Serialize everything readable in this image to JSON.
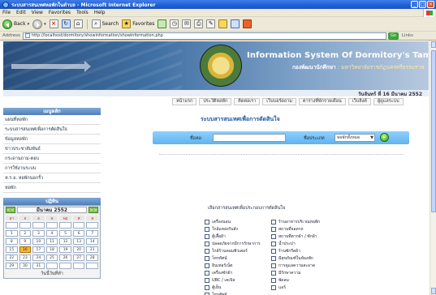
{
  "window": {
    "title": "ระบบสารสนเทศหอพักในตำบล - Microsoft Internet Explorer",
    "menu": [
      "File",
      "Edit",
      "View",
      "Favorites",
      "Tools",
      "Help"
    ],
    "toolbar": {
      "back": "Back",
      "search": "Search",
      "favorites": "Favorites"
    },
    "address_label": "Address",
    "address_url": "http://localhost/dormitory/showinformation/showinformation.php",
    "go_label": "Go",
    "links_label": "Links"
  },
  "banner": {
    "title": "Information System Of Dormitory's Tambon Thangew",
    "subtitle": "กองพัฒนานักศึกษา",
    "subtitle_extra": ": มหาวิทยาลัยราชภัฏนครศรีธรรมราช"
  },
  "date_text": "วันจันทร์ ที่ 16 มีนาคม 2552",
  "top_nav": [
    "หน้าแรก",
    "ประวัติหอพัก",
    "ติดต่อเรา",
    "เว็บบอร์ดถาม",
    "ตารางที่พักรายเดือน",
    "เว็บลิงค์",
    "ผู้ดูแลระบบ"
  ],
  "sidebar": {
    "menu_title": "เมนูหลัก",
    "items": [
      "แผนที่หอพัก",
      "ระบบสารสนเทศเพื่อการตัดสินใจ",
      "ข้อมูลหอพัก",
      "ข่าวประชาสัมพันธ์",
      "กระดานถาม-ตอบ",
      "การใช้งานระบบ",
      "ห.ร.อ. หอพักนอกรั้ว",
      "หอพัก"
    ],
    "calendar_title": "ปฏิทิน",
    "calendar_month": "มีนาคม 2552",
    "calendar_prev": "<<",
    "calendar_next": ">>",
    "day_headers": [
      "อา",
      "จ",
      "อ",
      "พ",
      "พฤ",
      "ศ",
      "ส"
    ],
    "days": [
      "",
      "",
      "",
      "",
      "",
      "",
      "",
      "1",
      "2",
      "3",
      "4",
      "5",
      "6",
      "7",
      "8",
      "9",
      "10",
      "11",
      "12",
      "13",
      "14",
      "15",
      "16",
      "17",
      "18",
      "19",
      "20",
      "21",
      "22",
      "23",
      "24",
      "25",
      "26",
      "27",
      "28",
      "29",
      "30",
      "31",
      "",
      "",
      "",
      ""
    ],
    "today": "16",
    "calendar_footer": "วันนี้วันที่ทำ"
  },
  "main": {
    "title": "ระบบสารสนเทศเพื่อการตัดสินใจ",
    "search": {
      "name_label": "ชื่อหอ",
      "name_value": "",
      "type_label": "ชื่อประเภท",
      "type_value": "หอพักทั้งหมด",
      "go": "Go"
    },
    "category_title": "เลือกสารสนเทศเพื่อประกอบการตัดสินใจ",
    "categories_left": [
      "เครื่องนอน",
      "ใกล้แหล่งรับสัง",
      "ตู้เสื้อผ้า",
      "ปลอดภัยจากมีการรักษาการ",
      "ใกล้ร้านคอมพิวเตอร์",
      "โทรทัศน์",
      "อินเทอร์เน็ต",
      "เครื่องซักผ้า",
      "UBC / เคเบิล",
      "ตู้เย็น",
      "โทรศัพท์"
    ],
    "categories_right": [
      "ร้านอาหารบริเวณหอพัก",
      "สถานที่จอดรถ",
      "สถานที่ตากผ้า / ซักผ้า",
      "น้ำประปา",
      "ร้านซักรีดผ้า",
      "มีสุขภัณฑ์ในห้องพัก",
      "การดูแลความสะอาด",
      "มีรักษาความ",
      "พัดลม",
      "แอร์"
    ]
  }
}
